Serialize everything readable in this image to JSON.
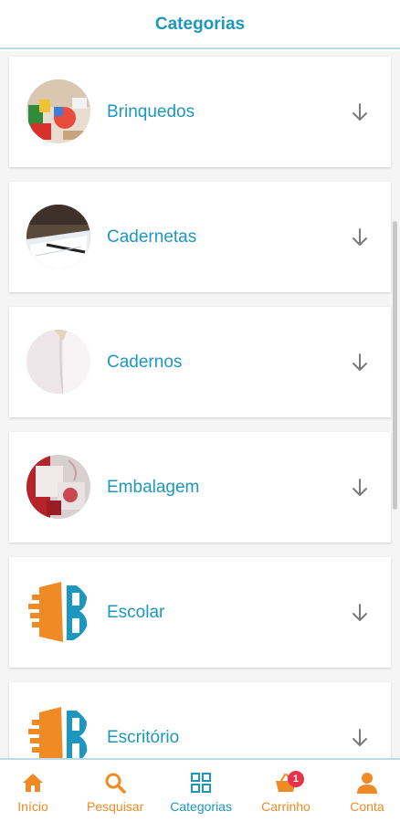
{
  "header": {
    "title": "Categorias"
  },
  "categories": [
    {
      "label": "Brinquedos"
    },
    {
      "label": "Cadernetas"
    },
    {
      "label": "Cadernos"
    },
    {
      "label": "Embalagem"
    },
    {
      "label": "Escolar"
    },
    {
      "label": "Escritório"
    }
  ],
  "tabbar": {
    "items": [
      {
        "label": "Início"
      },
      {
        "label": "Pesquisar"
      },
      {
        "label": "Categorias"
      },
      {
        "label": "Carrinho",
        "badge": "1"
      },
      {
        "label": "Conta"
      }
    ]
  },
  "colors": {
    "accent_blue": "#1d97bd",
    "accent_orange": "#f08a24",
    "badge_red": "#e8334a"
  }
}
